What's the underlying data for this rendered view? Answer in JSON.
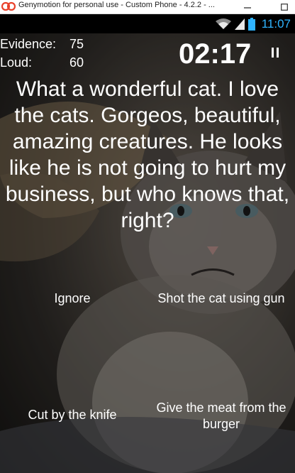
{
  "window": {
    "title": "Genymotion for personal use - Custom Phone - 4.2.2 - ...",
    "min_symbol": "—",
    "max_symbol": "☐"
  },
  "statusbar": {
    "time": "11:07",
    "accent_color": "#2fb4ff",
    "icons": [
      "wifi-icon",
      "signal-icon",
      "battery-icon"
    ]
  },
  "game": {
    "stats": {
      "evidence_label": "Evidence:",
      "evidence_value": "75",
      "loud_label": "Loud:",
      "loud_value": "60"
    },
    "timer": "02:17",
    "story": "What a wonderful cat. I love the cats. Gorgeos, beautiful, amazing creatures. He looks like he is not going to hurt my business, but who knows that, right?",
    "choices": [
      {
        "label": "Ignore"
      },
      {
        "label": "Shot the cat using gun"
      },
      {
        "label": "Cut by the knife"
      },
      {
        "label": "Give the meat from the burger"
      }
    ]
  }
}
